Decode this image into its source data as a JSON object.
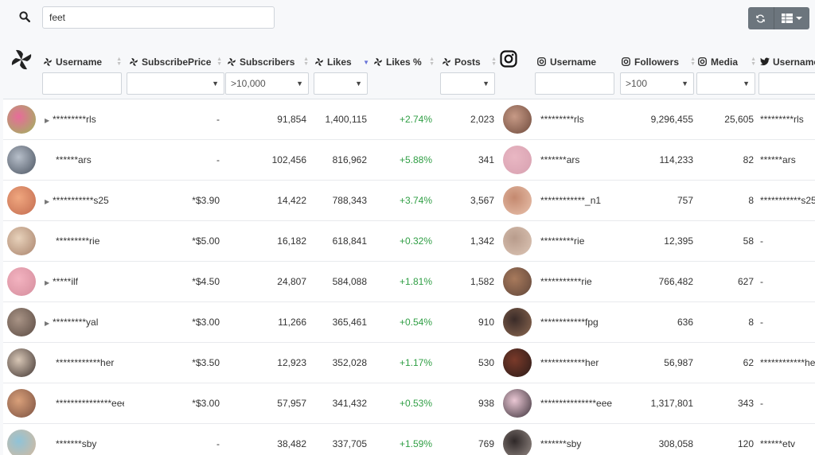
{
  "search": {
    "value": "feet"
  },
  "toolbar": {
    "refresh_icon": "refresh-icon",
    "view_icon": "grid-view-icon"
  },
  "columns": {
    "of_username": "Username",
    "of_price": "SubscribePrice",
    "of_subscribers": "Subscribers",
    "of_likes": "Likes",
    "of_likes_pct": "Likes %",
    "of_posts": "Posts",
    "ig_username": "Username",
    "ig_followers": "Followers",
    "ig_media": "Media",
    "tw_username": "Username"
  },
  "filters": {
    "subscribers": ">10,000",
    "followers": ">100"
  },
  "colors": {
    "positive": "#2f9e44",
    "sort_active": "#6873d8",
    "button": "#6c757d"
  },
  "rows": [
    {
      "expand": true,
      "of_user": "*********rls",
      "price": "-",
      "subs": "91,854",
      "likes": "1,400,115",
      "pct": "+2.74%",
      "posts": "2,023",
      "ig_user": "*********rls",
      "followers": "9,296,455",
      "media": "25,605",
      "tw_user": "*********rls",
      "av1": [
        "#e86b9a",
        "#9bb85a"
      ],
      "av2": [
        "#c79a86",
        "#6e4a3c"
      ]
    },
    {
      "expand": false,
      "of_user": "******ars",
      "price": "-",
      "subs": "102,456",
      "likes": "816,962",
      "pct": "+5.88%",
      "posts": "341",
      "ig_user": "*******ars",
      "followers": "114,233",
      "media": "82",
      "tw_user": "******ars",
      "av1": [
        "#b7bfca",
        "#4a5360"
      ],
      "av2": [
        "#e9b7c3",
        "#d7a0b0"
      ]
    },
    {
      "expand": true,
      "of_user": "***********s25",
      "price": "*$3.90",
      "subs": "14,422",
      "likes": "788,343",
      "pct": "+3.74%",
      "posts": "3,567",
      "ig_user": "************_n1",
      "followers": "757",
      "media": "8",
      "tw_user": "***********s25",
      "av1": [
        "#f0a77f",
        "#c26b4f"
      ],
      "av2": [
        "#c4896f",
        "#e9c2ad"
      ]
    },
    {
      "expand": false,
      "of_user": "*********rie",
      "price": "*$5.00",
      "subs": "16,182",
      "likes": "618,841",
      "pct": "+0.32%",
      "posts": "1,342",
      "ig_user": "*********rie",
      "followers": "12,395",
      "media": "58",
      "tw_user": "-",
      "av1": [
        "#e8d2bb",
        "#a8826b"
      ],
      "av2": [
        "#b89c8c",
        "#ddc6b6"
      ]
    },
    {
      "expand": true,
      "of_user": "*****ilf",
      "price": "*$4.50",
      "subs": "24,807",
      "likes": "584,088",
      "pct": "+1.81%",
      "posts": "1,582",
      "ig_user": "***********rie",
      "followers": "766,482",
      "media": "627",
      "tw_user": "-",
      "av1": [
        "#f3b3c0",
        "#d48c9c"
      ],
      "av2": [
        "#a87a5c",
        "#60463a"
      ]
    },
    {
      "expand": true,
      "of_user": "*********yal",
      "price": "*$3.00",
      "subs": "11,266",
      "likes": "365,461",
      "pct": "+0.54%",
      "posts": "910",
      "ig_user": "************fpg",
      "followers": "636",
      "media": "8",
      "tw_user": "-",
      "av1": [
        "#a99486",
        "#5a4a42"
      ],
      "av2": [
        "#3a2b28",
        "#8e6a52"
      ]
    },
    {
      "expand": false,
      "of_user": "************her",
      "price": "*$3.50",
      "subs": "12,923",
      "likes": "352,028",
      "pct": "+1.17%",
      "posts": "530",
      "ig_user": "************her",
      "followers": "56,987",
      "media": "62",
      "tw_user": "************her",
      "av1": [
        "#d8c7b6",
        "#3f3330"
      ],
      "av2": [
        "#7a3a2a",
        "#2a1b18"
      ]
    },
    {
      "expand": false,
      "of_user": "***************eee",
      "price": "*$3.00",
      "subs": "57,957",
      "likes": "341,432",
      "pct": "+0.53%",
      "posts": "938",
      "ig_user": "***************eee",
      "followers": "1,317,801",
      "media": "343",
      "tw_user": "-",
      "av1": [
        "#d9a07a",
        "#7a5040"
      ],
      "av2": [
        "#eac7d4",
        "#3a3038"
      ]
    },
    {
      "expand": false,
      "of_user": "*******sby",
      "price": "-",
      "subs": "38,482",
      "likes": "337,705",
      "pct": "+1.59%",
      "posts": "769",
      "ig_user": "*******sby",
      "followers": "308,058",
      "media": "120",
      "tw_user": "******etv",
      "av1": [
        "#8fc3d8",
        "#d9b99a"
      ],
      "av2": [
        "#2f2828",
        "#9a8f8a"
      ]
    }
  ]
}
